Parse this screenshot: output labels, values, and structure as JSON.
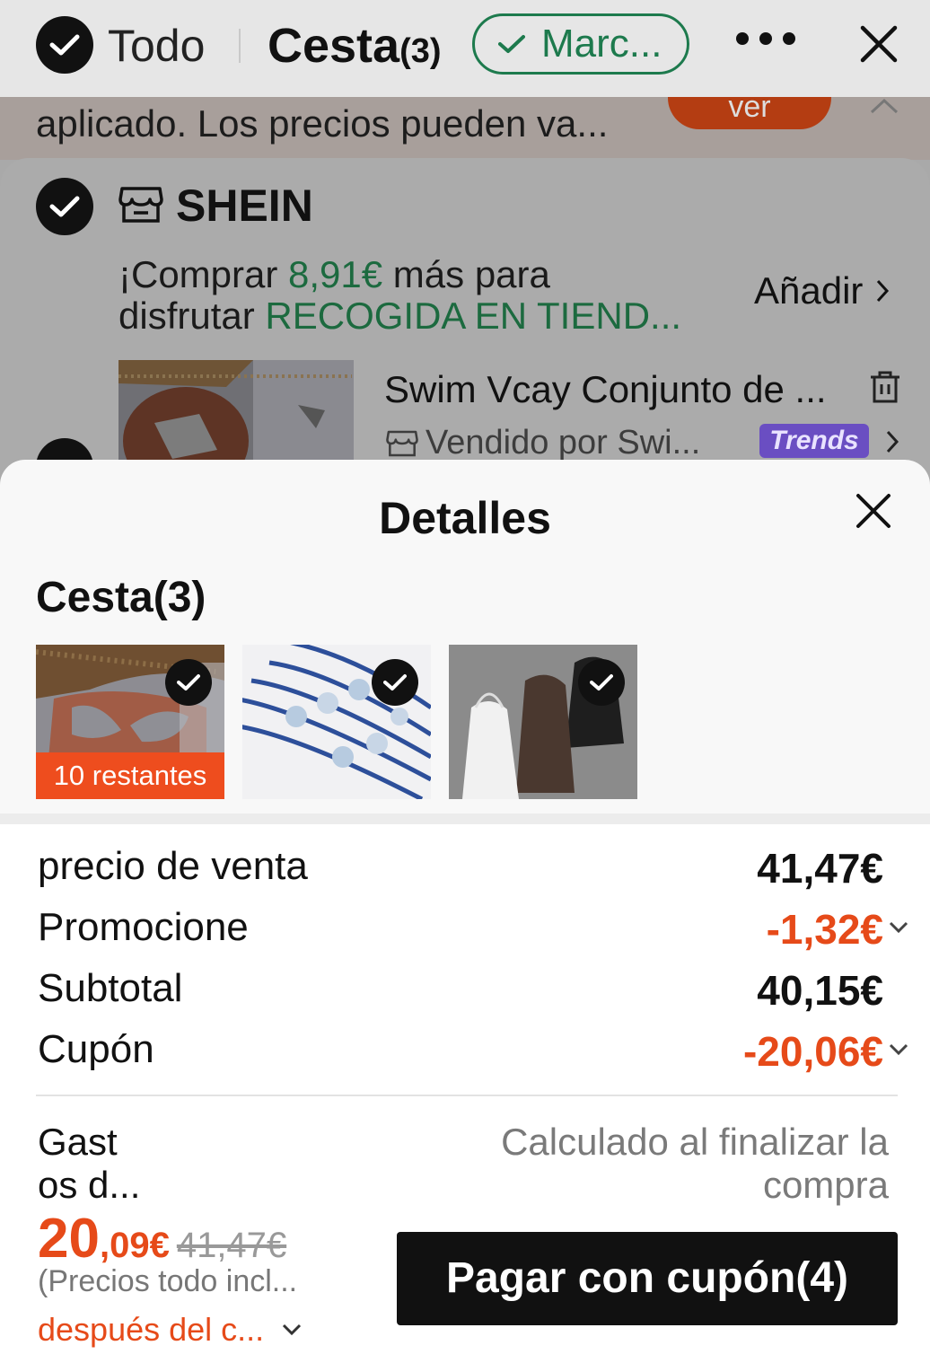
{
  "header": {
    "select_all_label": "Todo",
    "cart_title": "Cesta",
    "cart_count": "(3)",
    "mark_pill": "Marc..."
  },
  "notice": {
    "text": "aplicado. Los precios pueden va...",
    "button": "ver"
  },
  "store": {
    "name": "SHEIN",
    "promo_prefix": "¡Comprar ",
    "promo_amount": "8,91€",
    "promo_mid": " más para",
    "promo_line2_prefix": "disfrutar ",
    "promo_line2_highlight": "RECOGIDA EN TIEND...",
    "add_link": "Añadir",
    "product_title": "Swim Vcay Conjunto de ...",
    "sold_by": "Vendido por Swi...",
    "trends_badge": "Trends"
  },
  "details": {
    "title": "Detalles",
    "cart_heading": "Cesta(3)",
    "items": [
      {
        "name": "bikini",
        "badge": "10 restantes"
      },
      {
        "name": "pulseras"
      },
      {
        "name": "tops"
      }
    ],
    "rows": [
      {
        "label": "precio de venta",
        "value": "41,47€"
      },
      {
        "label": "Promocione",
        "value": "-1,32€"
      },
      {
        "label": "Subtotal",
        "value": "40,15€"
      },
      {
        "label": "Cupón",
        "value": "-20,06€"
      }
    ],
    "shipping_label_1": "Gast",
    "shipping_label_2": "os d...",
    "shipping_value_1": "Calculado al finalizar la",
    "shipping_value_2": "compra",
    "total_int": "20",
    "total_dec": ",09€",
    "total_original": "41,47€",
    "tax_note": "(Precios todo incl...",
    "after_coupon": "después del c...",
    "pay_button": "Pagar con cupón(4)"
  },
  "colors": {
    "accent_orange": "#e64a19",
    "green": "#1d7a4d",
    "trends_purple": "#6a4ec2"
  }
}
